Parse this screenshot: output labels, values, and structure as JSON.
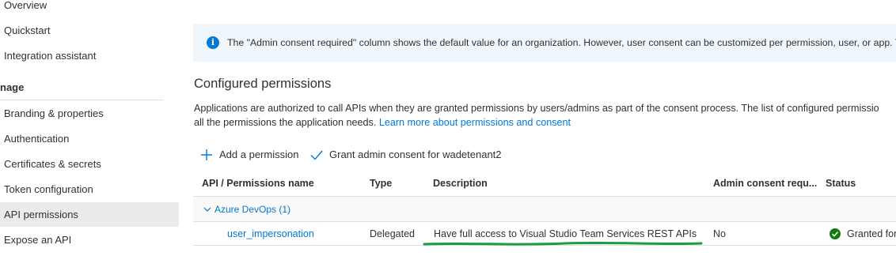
{
  "sidebar": {
    "items": [
      {
        "label": "Overview"
      },
      {
        "label": "Quickstart"
      },
      {
        "label": "Integration assistant"
      }
    ],
    "section_label": "nage",
    "manage_items": [
      {
        "label": "Branding & properties"
      },
      {
        "label": "Authentication"
      },
      {
        "label": "Certificates & secrets"
      },
      {
        "label": "Token configuration"
      },
      {
        "label": "API permissions",
        "selected": true
      },
      {
        "label": "Expose an API"
      }
    ]
  },
  "info_bar": {
    "icon": "info-icon",
    "text": "The \"Admin consent required\" column shows the default value for an organization. However, user consent can be customized per permission, user, or app. This c"
  },
  "configured": {
    "title": "Configured permissions",
    "desc_line1": "Applications are authorized to call APIs when they are granted permissions by users/admins as part of the consent process. The list of configured permissio",
    "desc_line2_prefix": "all the permissions the application needs.",
    "learn_more": "Learn more about permissions and consent"
  },
  "toolbar": {
    "add_permission": "Add a permission",
    "grant_consent": "Grant admin consent for wadetenant2"
  },
  "table": {
    "headers": {
      "name": "API / Permissions name",
      "type": "Type",
      "description": "Description",
      "admin_consent": "Admin consent requ...",
      "status": "Status"
    },
    "group": {
      "label": "Azure DevOps (1)"
    },
    "rows": [
      {
        "name": "user_impersonation",
        "type": "Delegated",
        "description": "Have full access to Visual Studio Team Services REST APIs",
        "admin_consent": "No",
        "status": "Granted for"
      }
    ]
  },
  "colors": {
    "accent": "#0078d4",
    "selected_nav": "#edebe9",
    "info_bg": "#eff6fc",
    "success": "#107c10",
    "annotation": "#1a9c3e"
  }
}
